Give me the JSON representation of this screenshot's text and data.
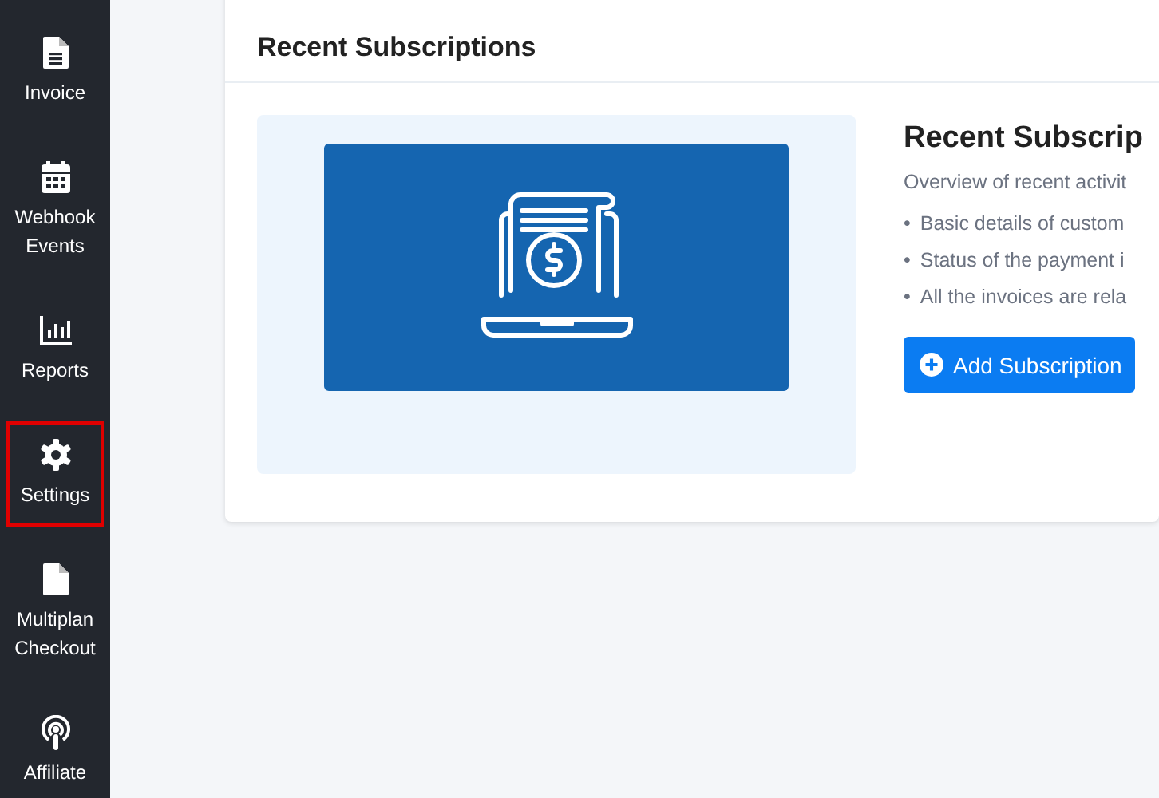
{
  "sidebar": {
    "items": [
      {
        "label": "Invoice",
        "highlighted": false
      },
      {
        "label": "Webhook Events",
        "highlighted": false
      },
      {
        "label": "Reports",
        "highlighted": false
      },
      {
        "label": "Settings",
        "highlighted": true
      },
      {
        "label": "Multiplan Checkout",
        "highlighted": false
      },
      {
        "label": "Affiliate",
        "highlighted": false
      }
    ]
  },
  "card": {
    "title": "Recent Subscriptions",
    "heading": "Recent Subscrip",
    "description": "Overview of recent activit",
    "bullets": [
      {
        "marker": "•",
        "text": "Basic details of custom"
      },
      {
        "marker": "•",
        "text": "Status of the payment i"
      },
      {
        "marker": "•",
        "text": "All the invoices are rela"
      }
    ],
    "button": "Add Subscription"
  }
}
